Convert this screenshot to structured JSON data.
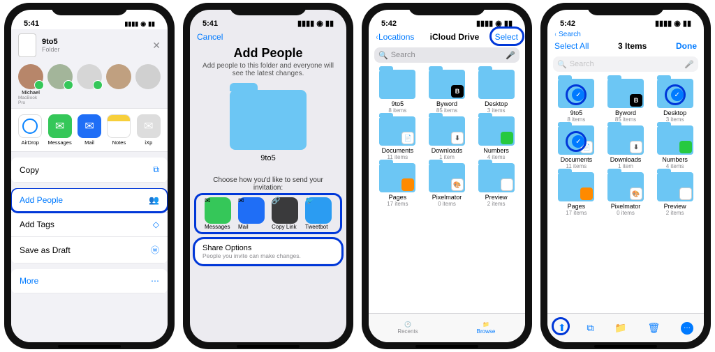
{
  "status": {
    "time1": "5:41",
    "time2": "5:42"
  },
  "screen1": {
    "file_name": "9to5",
    "file_kind": "Folder",
    "contacts": [
      {
        "name": "Michael",
        "device": "MacBook Pro",
        "avatar": "#b7866a"
      },
      {
        "name": "",
        "avatar": "#a3b59a"
      },
      {
        "name": "",
        "avatar": "#d6d6d6"
      },
      {
        "name": "",
        "avatar": "#c0a080"
      },
      {
        "name": "",
        "avatar": "#d0d0d0"
      }
    ],
    "apps": [
      {
        "label": "AirDrop",
        "bg": "#ffffff",
        "ring": true
      },
      {
        "label": "Messages",
        "bg": "#35c759"
      },
      {
        "label": "Mail",
        "bg": "#1f6ef6"
      },
      {
        "label": "Notes",
        "bg": "#ffffff",
        "stripe": "#f7cf3b"
      },
      {
        "label": "iXp"
      }
    ],
    "actions": {
      "copy": "Copy",
      "add_people": "Add People",
      "add_tags": "Add Tags",
      "save_draft": "Save as Draft",
      "more": "More"
    }
  },
  "screen2": {
    "cancel": "Cancel",
    "title": "Add People",
    "subtitle": "Add people to this folder and everyone will see the latest changes.",
    "folder_name": "9to5",
    "instruction": "Choose how you'd like to send your invitation:",
    "apps": [
      {
        "label": "Messages",
        "bg": "#35c759"
      },
      {
        "label": "Mail",
        "bg": "#1f6ef6"
      },
      {
        "label": "Copy Link",
        "bg": "#3a3a3c"
      },
      {
        "label": "Tweetbot",
        "bg": "#2b9cf2"
      }
    ],
    "share_options_label": "Share Options",
    "share_options_sub": "People you invite can make changes."
  },
  "screen3": {
    "back": "Locations",
    "title": "iCloud Drive",
    "select": "Select",
    "search_placeholder": "Search",
    "folders": [
      {
        "name": "9to5",
        "sub": "8 items",
        "badge": null
      },
      {
        "name": "Byword",
        "sub": "85 items",
        "badge": {
          "bg": "#000",
          "txt": "B"
        }
      },
      {
        "name": "Desktop",
        "sub": "3 items",
        "badge": null
      },
      {
        "name": "Documents",
        "sub": "11 items",
        "badge": {
          "bg": "#fff",
          "txt": "📄"
        }
      },
      {
        "name": "Downloads",
        "sub": "1 item",
        "badge": {
          "bg": "#fff",
          "txt": "⬇"
        }
      },
      {
        "name": "Numbers",
        "sub": "4 items",
        "badge": {
          "bg": "#26c940",
          "txt": ""
        }
      },
      {
        "name": "Pages",
        "sub": "17 items",
        "badge": {
          "bg": "#ff8a00",
          "txt": ""
        }
      },
      {
        "name": "Pixelmator",
        "sub": "0 items",
        "badge": {
          "bg": "#fff",
          "txt": "🎨"
        }
      },
      {
        "name": "Preview",
        "sub": "2 items",
        "badge": {
          "bg": "#fff",
          "txt": ""
        }
      }
    ],
    "tabs": {
      "recents": "Recents",
      "browse": "Browse"
    }
  },
  "screen4": {
    "select_all": "Select All",
    "title": "3 Items",
    "done": "Done",
    "search_placeholder": "Search",
    "selected_indices": [
      0,
      2,
      3
    ],
    "toolbar": {
      "share": "share",
      "duplicate": "duplicate",
      "move": "move",
      "trash": "trash",
      "more": "more"
    }
  }
}
